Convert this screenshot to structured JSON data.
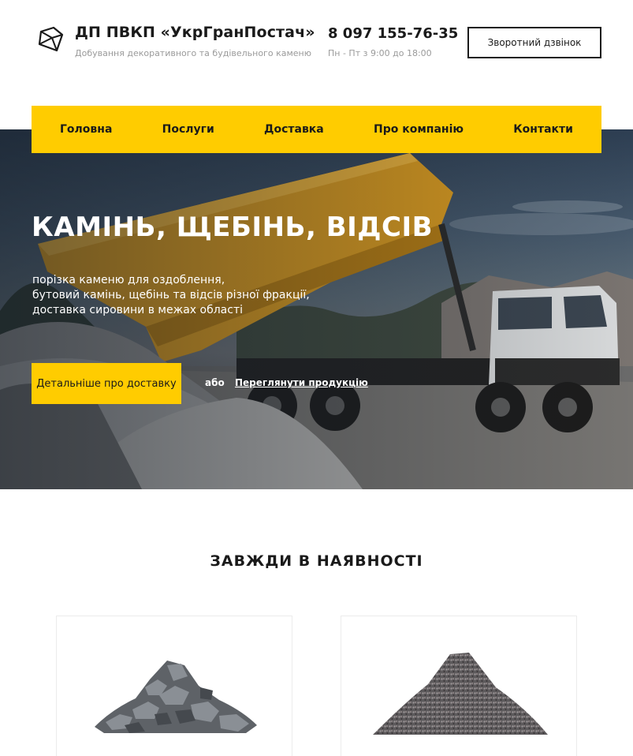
{
  "header": {
    "brand_name": "ДП ПВКП «УкрГранПостач»",
    "tagline": "Добування декоративного та будівельного каменю",
    "phone": "8 097 155-76-35",
    "hours": "Пн - Пт з 9:00 до 18:00",
    "callback_label": "Зворотний дзвінок",
    "logo_icon": "gem-icon"
  },
  "nav": {
    "items": [
      {
        "label": "Головна"
      },
      {
        "label": "Послуги"
      },
      {
        "label": "Доставка"
      },
      {
        "label": "Про компанію"
      },
      {
        "label": "Контакти"
      }
    ]
  },
  "hero": {
    "title": "КАМІНЬ, ЩЕБІНЬ, ВІДСІВ",
    "subtitle_lines": [
      "порізка каменю для оздоблення,",
      "бутовий камінь, щебінь та відсів різної фракції,",
      "доставка сировини в межах області"
    ],
    "cta_label": "Детальніше про доставку",
    "or_text": "або",
    "secondary_link": "Переглянути продукцію",
    "image": "dump-truck-unloading-gravel"
  },
  "section": {
    "title": "ЗАВЖДИ В НАЯВНОСТІ",
    "cards": [
      {
        "image": "rubble-stone-pile"
      },
      {
        "image": "crushed-stone-pile"
      }
    ]
  },
  "colors": {
    "accent": "#ffcc00",
    "text_dark": "#1a1a1a",
    "text_muted": "#9a9a9a"
  }
}
